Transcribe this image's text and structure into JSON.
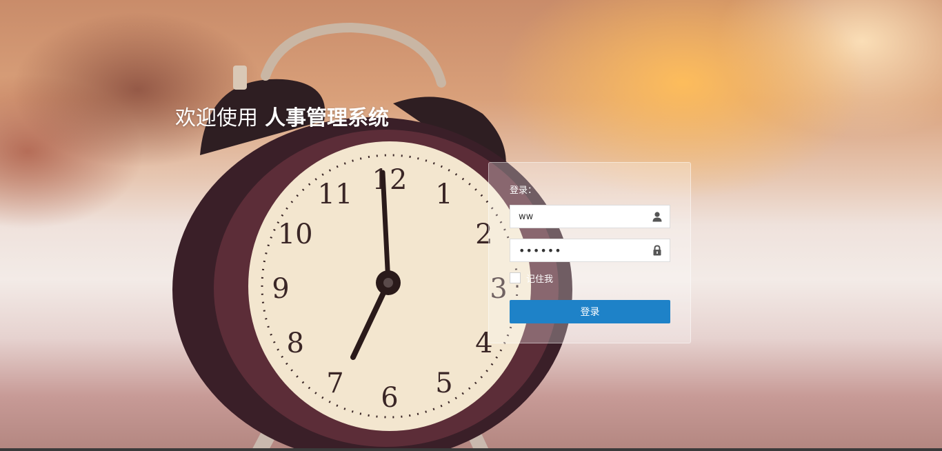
{
  "welcome": {
    "prefix": "欢迎使用",
    "system_name": "人事管理系统"
  },
  "login": {
    "heading": "登录：",
    "username_value": "ww",
    "password_value": "••••••",
    "user_icon": "user-icon",
    "lock_icon": "lock-icon",
    "remember_label": "记住我",
    "remember_checked": false,
    "submit_label": "登录"
  },
  "clock": {
    "numerals": [
      "12",
      "1",
      "2",
      "3",
      "4",
      "5",
      "6",
      "7",
      "8",
      "9",
      "10",
      "11"
    ]
  },
  "colors": {
    "button": "#1e82c8",
    "text": "#ffffff"
  }
}
